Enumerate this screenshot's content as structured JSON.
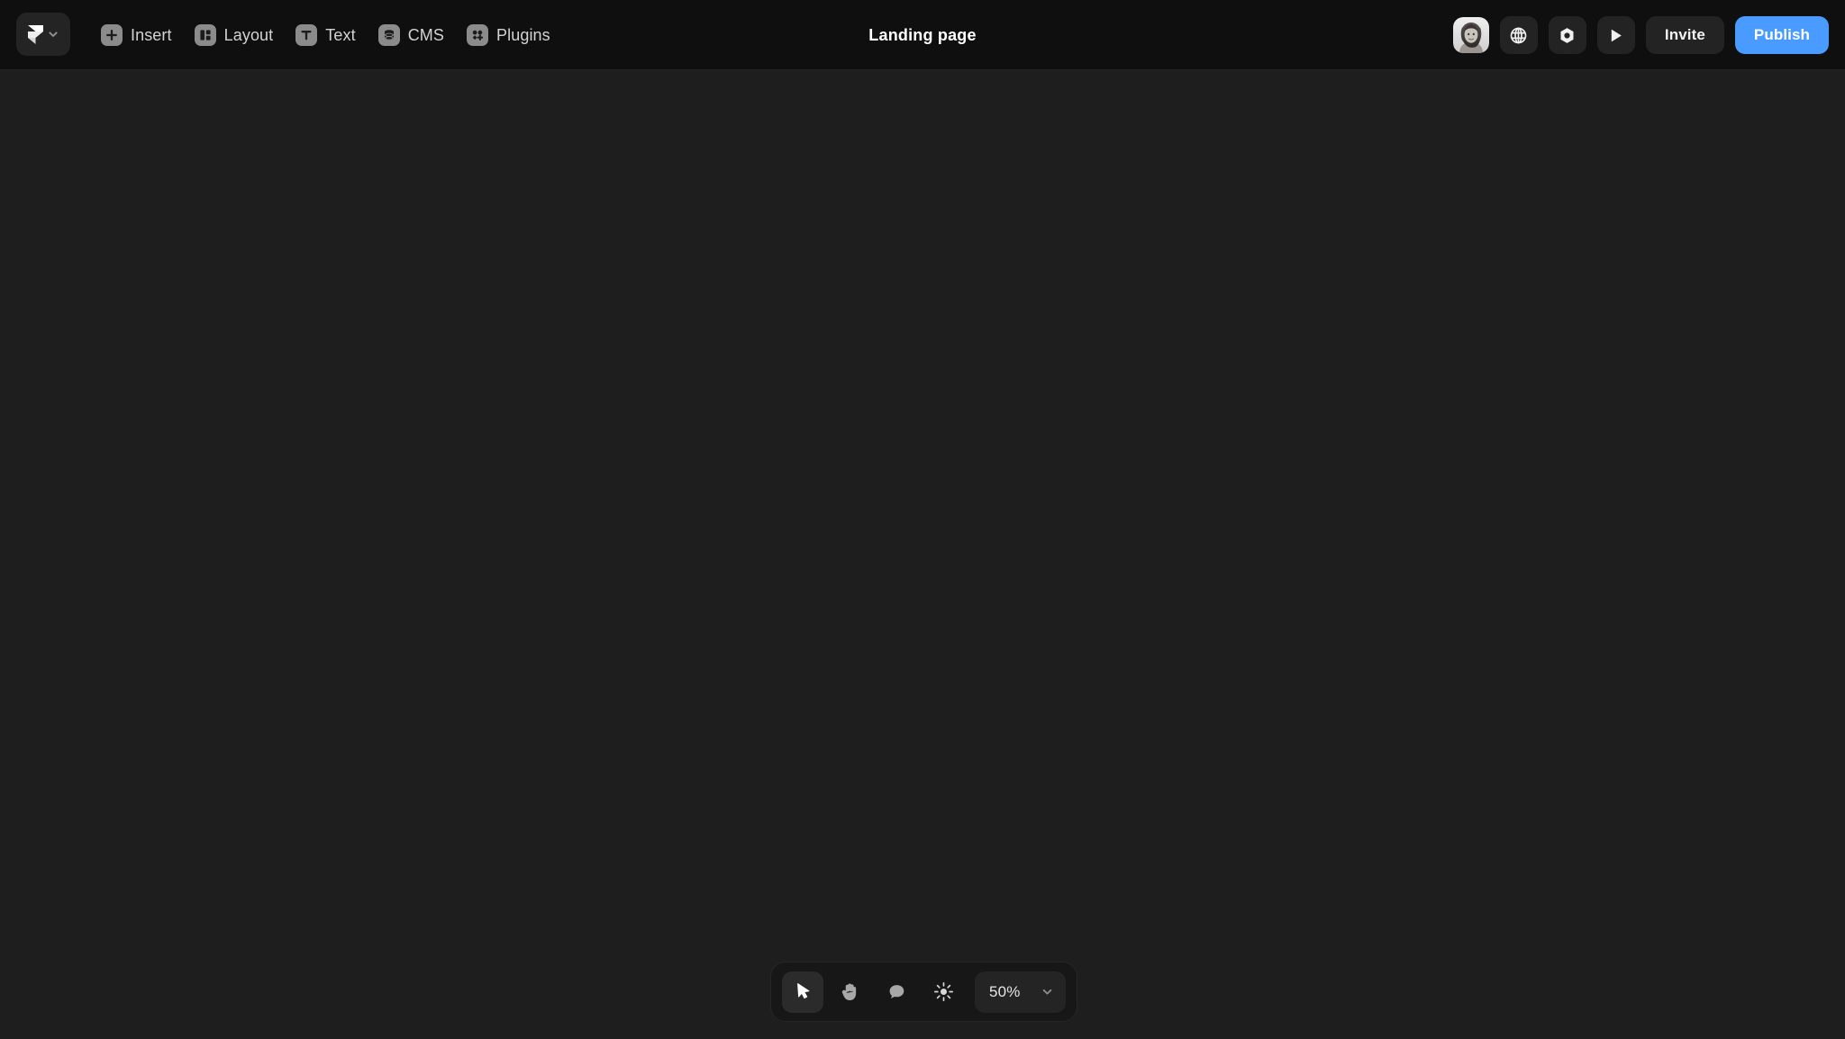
{
  "app": {
    "name": "Framer",
    "accent_color": "#4a9bff",
    "topbar_bg": "#0f0f0f",
    "canvas_bg": "#1e1e1e",
    "toolbar_bg": "#171717"
  },
  "topbar": {
    "logo": {
      "icon": "framer-logo-icon",
      "chevron": "chevron-down-icon"
    },
    "menu": [
      {
        "label": "Insert",
        "icon": "plus-square-icon"
      },
      {
        "label": "Layout",
        "icon": "layout-panels-icon"
      },
      {
        "label": "Text",
        "icon": "text-t-icon"
      },
      {
        "label": "CMS",
        "icon": "database-stack-icon"
      },
      {
        "label": "Plugins",
        "icon": "plugins-shapes-icon"
      }
    ],
    "title": "Landing page",
    "right": {
      "avatar": {
        "icon": "user-avatar-photo",
        "alt": "Account avatar"
      },
      "actions": [
        {
          "icon": "globe-icon",
          "name": "localization-button"
        },
        {
          "icon": "hexagon-nut-icon",
          "name": "components-button"
        },
        {
          "icon": "play-icon",
          "name": "preview-button"
        }
      ],
      "invite_label": "Invite",
      "publish_label": "Publish"
    }
  },
  "canvas": {
    "empty": true
  },
  "bottom_toolbar": {
    "tools": [
      {
        "name": "select-tool",
        "icon": "cursor-arrow-icon",
        "active": true
      },
      {
        "name": "hand-tool",
        "icon": "hand-icon",
        "active": false
      },
      {
        "name": "comment-tool",
        "icon": "comment-bubble-icon",
        "active": false
      },
      {
        "name": "appearance-tool",
        "icon": "sun-brightness-icon",
        "active": false
      }
    ],
    "zoom": {
      "value": "50%",
      "chevron": "chevron-down-icon"
    }
  }
}
